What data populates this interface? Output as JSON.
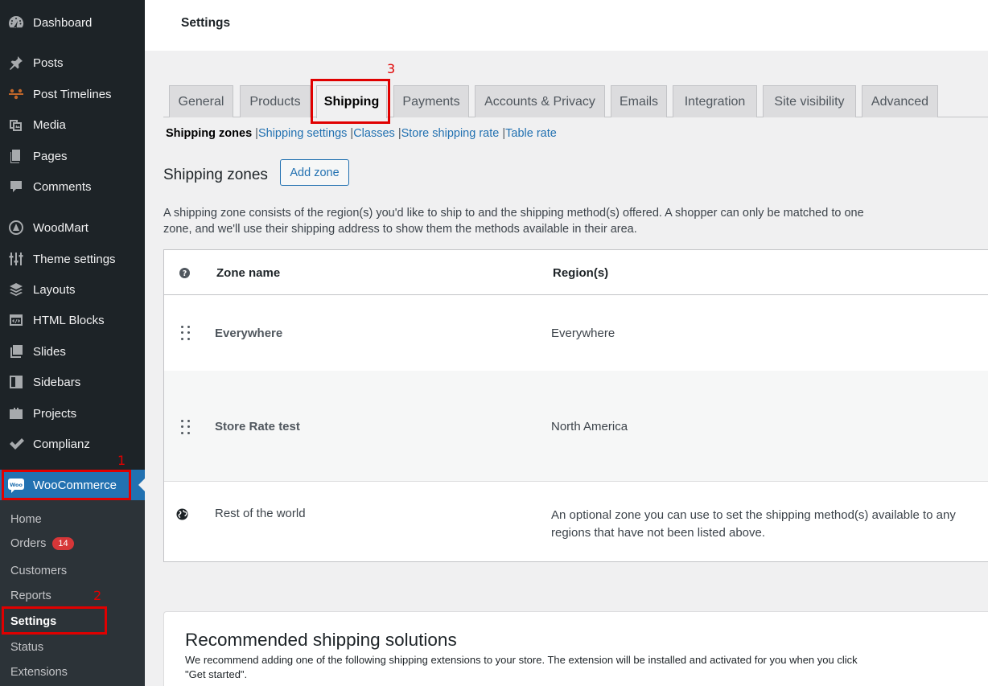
{
  "sidebar": {
    "items": [
      {
        "label": "Dashboard",
        "icon": "dashboard-icon"
      },
      {
        "label": "Posts",
        "icon": "pin-icon"
      },
      {
        "label": "Post Timelines",
        "icon": "timeline-icon"
      },
      {
        "label": "Media",
        "icon": "media-icon"
      },
      {
        "label": "Pages",
        "icon": "pages-icon"
      },
      {
        "label": "Comments",
        "icon": "comment-icon"
      },
      {
        "label": "WoodMart",
        "icon": "woodmart-icon"
      },
      {
        "label": "Theme settings",
        "icon": "sliders-icon"
      },
      {
        "label": "Layouts",
        "icon": "layers-icon"
      },
      {
        "label": "HTML Blocks",
        "icon": "code-block-icon"
      },
      {
        "label": "Slides",
        "icon": "slides-icon"
      },
      {
        "label": "Sidebars",
        "icon": "sidebar-icon"
      },
      {
        "label": "Projects",
        "icon": "briefcase-icon"
      },
      {
        "label": "Complianz",
        "icon": "checkmark-icon"
      }
    ],
    "active": {
      "label": "WooCommerce",
      "icon": "woo-icon"
    },
    "submenu": [
      {
        "label": "Home"
      },
      {
        "label": "Orders",
        "badge": "14"
      },
      {
        "label": "Customers"
      },
      {
        "label": "Reports"
      },
      {
        "label": "Settings"
      },
      {
        "label": "Status"
      },
      {
        "label": "Extensions"
      }
    ]
  },
  "annotations": [
    "1",
    "2",
    "3"
  ],
  "header": {
    "title": "Settings"
  },
  "tabs": [
    {
      "label": "General"
    },
    {
      "label": "Products"
    },
    {
      "label": "Shipping"
    },
    {
      "label": "Payments"
    },
    {
      "label": "Accounts & Privacy"
    },
    {
      "label": "Emails"
    },
    {
      "label": "Integration"
    },
    {
      "label": "Site visibility"
    },
    {
      "label": "Advanced"
    }
  ],
  "subnav": {
    "current": "Shipping zones",
    "links": [
      "Shipping settings",
      "Classes",
      "Store shipping rate",
      "Table rate"
    ],
    "separator": "|"
  },
  "zones": {
    "title": "Shipping zones",
    "add_button": "Add zone",
    "description": "A shipping zone consists of the region(s) you'd like to ship to and the shipping method(s) offered. A shopper can only be matched to one zone, and we'll use their shipping address to show them the methods available in their area.",
    "columns": {
      "name": "Zone name",
      "regions": "Region(s)"
    },
    "rows": [
      {
        "name": "Everywhere",
        "region": "Everywhere"
      },
      {
        "name": "Store Rate test",
        "region": "North America"
      }
    ],
    "rest": {
      "name": "Rest of the world",
      "region": "An optional zone you can use to set the shipping method(s) available to any regions that have not been listed above."
    }
  },
  "recommended": {
    "title": "Recommended shipping solutions",
    "text": "We recommend adding one of the following shipping extensions to your store. The extension will be installed and activated for you when you click \"Get started\"."
  }
}
